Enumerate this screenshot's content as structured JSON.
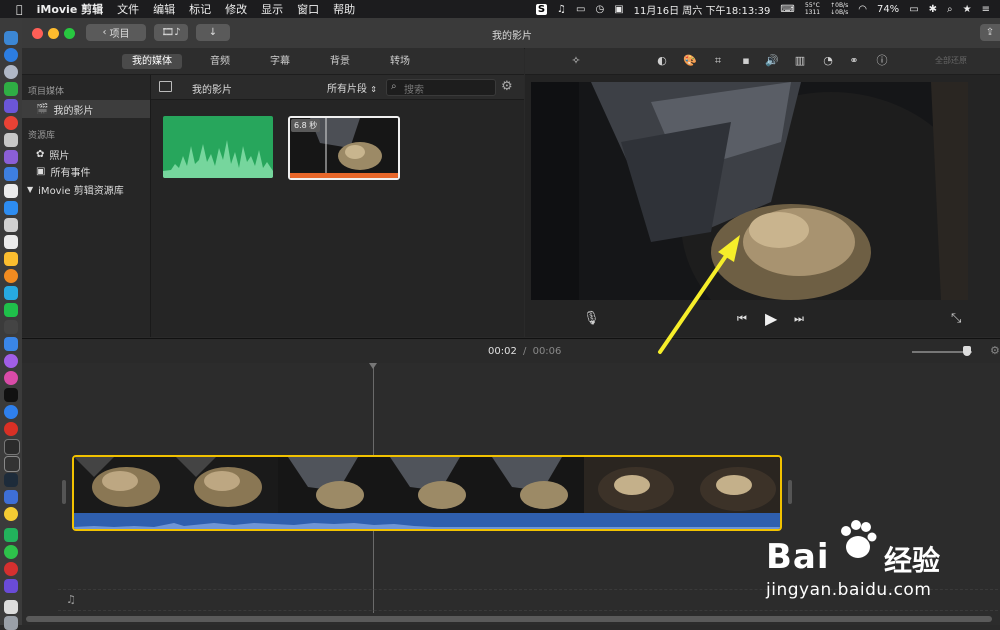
{
  "menubar": {
    "app": "iMovie 剪辑",
    "items": [
      "文件",
      "编辑",
      "标记",
      "修改",
      "显示",
      "窗口",
      "帮助"
    ],
    "datetime": "11月16日 周六 下午18:13:39",
    "temp_top": "55°C",
    "temp_bottom": "1311",
    "net_up": "0B/s",
    "net_down": "0B/s",
    "battery": "74%"
  },
  "window": {
    "title": "我的影片",
    "back_label": "项目"
  },
  "media_tabs": {
    "items": [
      "我的媒体",
      "音频",
      "字幕",
      "背景",
      "转场"
    ],
    "active": "我的媒体"
  },
  "sidebar": {
    "project_media_header": "项目媒体",
    "my_movie": "我的影片",
    "library_header": "资源库",
    "photos": "照片",
    "all_events": "所有事件",
    "library_name": "iMovie 剪辑资源库"
  },
  "browser": {
    "title": "我的影片",
    "filter": "所有片段",
    "search_placeholder": "搜索",
    "clip_duration": "6.8 秒"
  },
  "viewer": {
    "reset_all": "全部还原"
  },
  "timeline": {
    "current_time": "00:02",
    "separator": "/",
    "total_time": "00:06"
  },
  "watermark": {
    "brand": "Bai",
    "brand_cn": "经验",
    "url": "jingyan.baidu.com"
  },
  "colors": {
    "accent_yellow": "#f2c200",
    "audio_green": "#27a65c",
    "waveform_blue": "#2f5fae",
    "annotation_yellow": "#f6ee2a"
  }
}
